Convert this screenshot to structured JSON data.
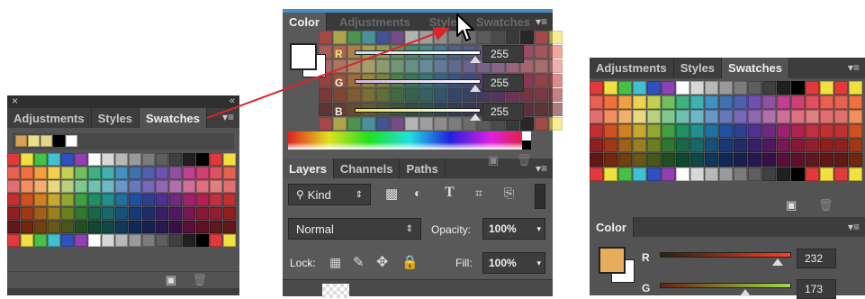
{
  "left_panel": {
    "close_icon": "×",
    "collapse_icon": "«",
    "tabs": [
      "Adjustments",
      "Styles",
      "Swatches"
    ],
    "active_tab": "Swatches",
    "recent_swatches": [
      "#d9a05b",
      "#e8e08a",
      "#e6d68a",
      "#000000",
      "#ffffff"
    ],
    "menu_icon": "▾≡"
  },
  "middle_panel": {
    "color_title": "Color",
    "ghost_tabs": [
      "Adjustments",
      "Styles",
      "Swatches"
    ],
    "channels": [
      {
        "label": "R",
        "value": "255"
      },
      {
        "label": "G",
        "value": "255"
      },
      {
        "label": "B",
        "value": "255"
      }
    ],
    "layers_tabs": [
      "Layers",
      "Channels",
      "Paths"
    ],
    "kind_label": "Kind",
    "blend_mode": "Normal",
    "opacity_label": "Opacity:",
    "opacity_value": "100%",
    "lock_label": "Lock:",
    "fill_label": "Fill:",
    "fill_value": "100%"
  },
  "right_panel": {
    "tabs": [
      "Adjustments",
      "Styles",
      "Swatches"
    ],
    "active_tab": "Swatches",
    "color_title": "Color",
    "channels": [
      {
        "label": "R",
        "value": "232"
      },
      {
        "label": "G",
        "value": "173"
      }
    ],
    "foreground_color": "#e8ad5a"
  },
  "colors": {
    "panel_bg": "#535353",
    "tab_bar": "#3d3d3d",
    "arrow": "#d9262c"
  }
}
